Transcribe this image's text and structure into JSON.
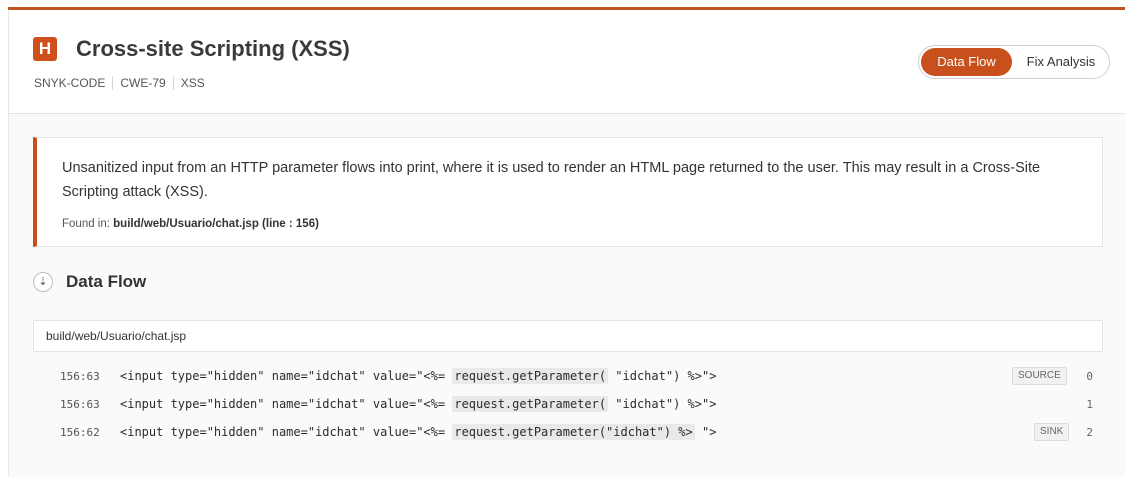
{
  "header": {
    "severity": "H",
    "title": "Cross-site Scripting (XSS)",
    "tags": [
      "SNYK-CODE",
      "CWE-79",
      "XSS"
    ],
    "tabs": {
      "active": "Data Flow",
      "inactive": "Fix Analysis"
    }
  },
  "alert": {
    "message": "Unsanitized input from an HTTP parameter flows into print, where it is used to render an HTML page returned to the user. This may result in a Cross-Site Scripting attack (XSS).",
    "found_label": "Found in: ",
    "found_value": "build/web/Usuario/chat.jsp (line : 156)"
  },
  "data_flow": {
    "icon": "⇣",
    "title": "Data Flow",
    "file": "build/web/Usuario/chat.jsp",
    "rows": [
      {
        "line": "156:63",
        "pre": "<input type=\"hidden\" name=\"idchat\" value=\"<%= ",
        "hl": "request.getParameter(",
        "post": " \"idchat\") %>\">",
        "badge": "SOURCE",
        "step": "0"
      },
      {
        "line": "156:63",
        "pre": "<input type=\"hidden\" name=\"idchat\" value=\"<%= ",
        "hl": "request.getParameter(",
        "post": " \"idchat\") %>\">",
        "badge": "",
        "step": "1"
      },
      {
        "line": "156:62",
        "pre": "<input type=\"hidden\" name=\"idchat\" value=\"<%= ",
        "hl": "request.getParameter(\"idchat\") %>",
        "post": " \">",
        "badge": "SINK",
        "step": "2"
      }
    ]
  }
}
